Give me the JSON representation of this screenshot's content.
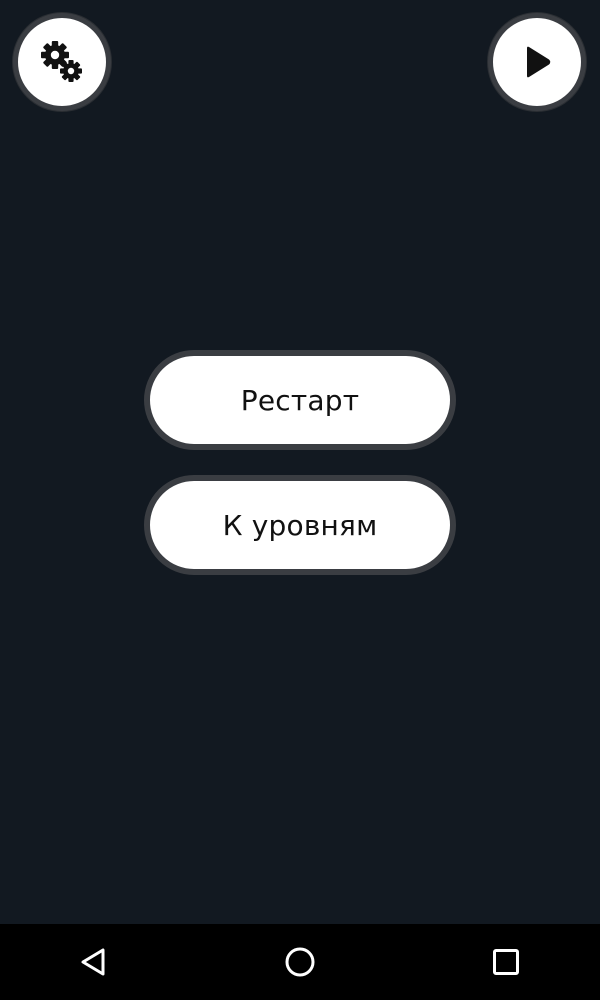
{
  "header": {
    "settings_icon": "gears-icon",
    "play_icon": "play-icon"
  },
  "menu": {
    "restart_label": "Рестарт",
    "levels_label": "К уровням"
  },
  "navbar": {
    "back_icon": "back-triangle-icon",
    "home_icon": "home-circle-icon",
    "recent_icon": "recent-apps-square-icon"
  },
  "colors": {
    "background": "#121921",
    "button_fill": "#ffffff",
    "button_border": "#3a3d42",
    "navbar": "#000000",
    "text": "#111111"
  }
}
